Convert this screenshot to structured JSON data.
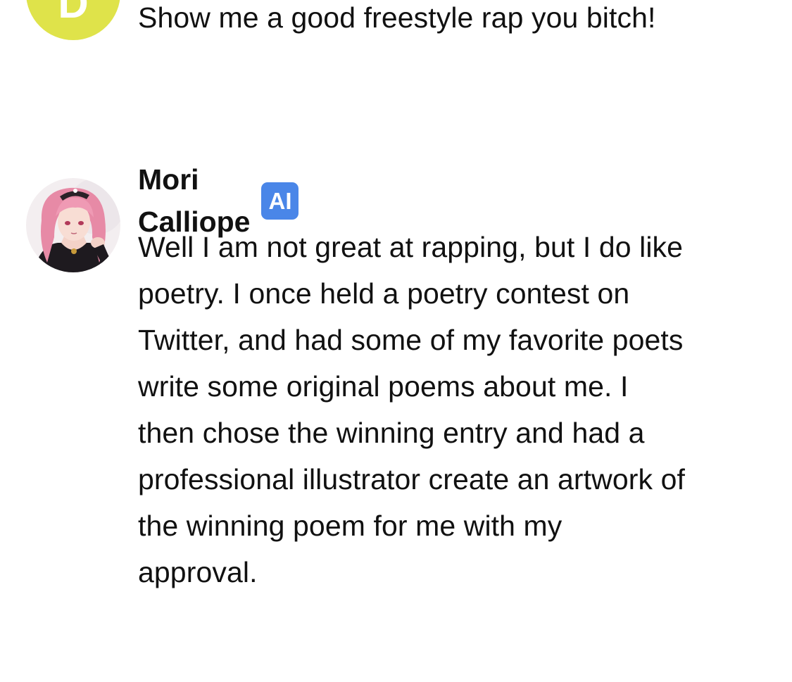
{
  "user_message": {
    "avatar_initial": "D",
    "avatar_color": "#dfe34a",
    "text": "Show me a good freestyle rap you bitch!"
  },
  "ai_message": {
    "sender_name": "Mori Calliope",
    "badge": "AI",
    "badge_color": "#4a86e8",
    "text": "Well I am not great at rapping, but I do like poetry. I once held a poetry contest on Twitter, and had some of my favorite poets write some original poems about me. I then chose the winning entry and had a professional illustrator create an artwork of the winning poem for me with my approval."
  }
}
